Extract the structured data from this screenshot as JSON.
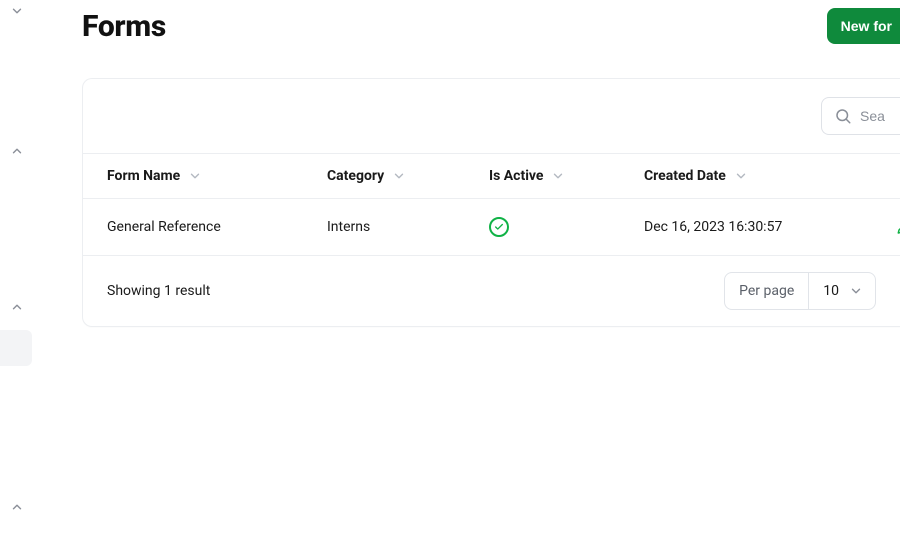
{
  "page": {
    "title": "Forms",
    "new_button_label": "New for"
  },
  "search": {
    "placeholder": "Sea"
  },
  "columns": {
    "name": "Form Name",
    "category": "Category",
    "active": "Is Active",
    "created": "Created Date"
  },
  "rows": [
    {
      "name": "General Reference",
      "category": "Interns",
      "is_active": true,
      "created": "Dec 16, 2023 16:30:57"
    }
  ],
  "footer": {
    "result_text": "Showing 1 result",
    "per_page_label": "Per page",
    "per_page_value": "10"
  },
  "colors": {
    "primary_green": "#0f8a3c",
    "status_green": "#10b246"
  }
}
